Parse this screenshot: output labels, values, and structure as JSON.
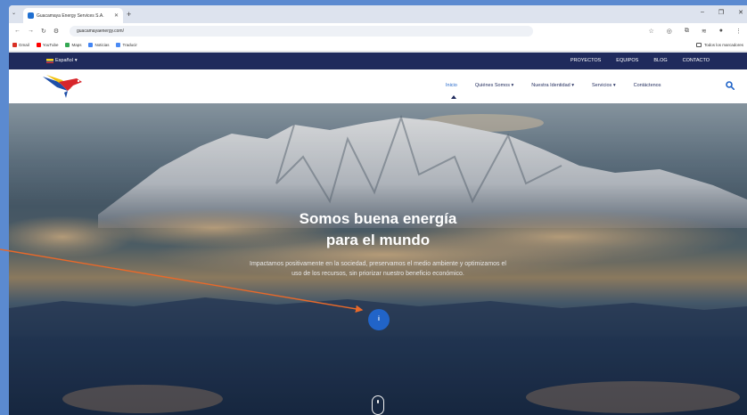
{
  "browser": {
    "tab_title": "Guacamaya Energy Services S.A.",
    "url": "guacamayaenergy.com/",
    "bookmarks": [
      "Gmail",
      "YouTube",
      "Maps",
      "Noticias",
      "Traducir"
    ],
    "all_bookmarks": "Todos los marcadores"
  },
  "site": {
    "language": "Español",
    "top_links": [
      "PROYECTOS",
      "EQUIPOS",
      "BLOG",
      "CONTACTO"
    ],
    "nav": [
      "Inicio",
      "Quiénes Somos",
      "Nuestra Identidad",
      "Servicios",
      "Contáctenos"
    ],
    "active_nav": "Inicio"
  },
  "hero": {
    "title_line1": "Somos buena energía",
    "title_line2": "para el mundo",
    "subtitle": "Impactamos positivamente en la sociedad, preservamos el medio ambiente y optimizamos el uso de los recursos, sin priorizar nuestro beneficio económico.",
    "info_button": "i"
  },
  "colors": {
    "topbar": "#1f2a5c",
    "accent": "#2164c8",
    "annotation_arrow": "#e8692a",
    "outer_background": "#5b8ad0"
  }
}
